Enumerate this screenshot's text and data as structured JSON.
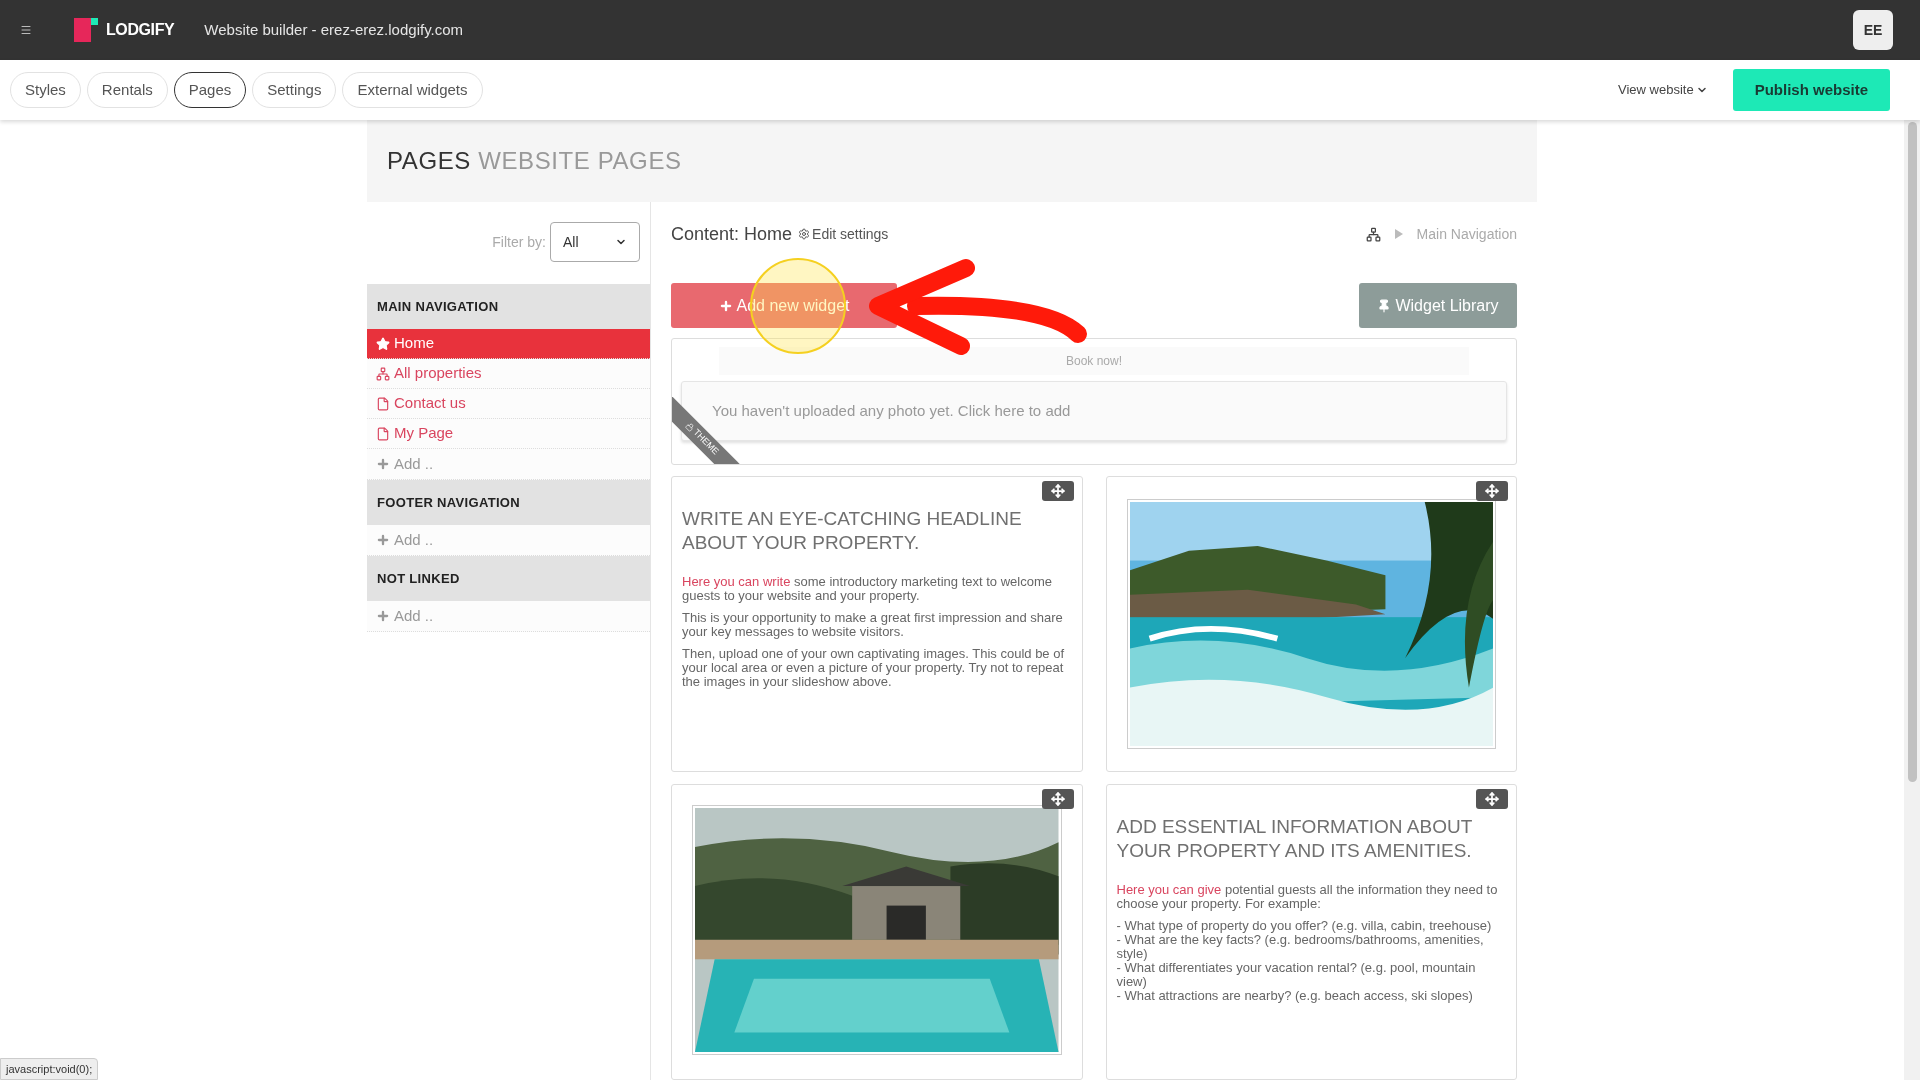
{
  "app": {
    "logo": "LODGIFY",
    "title": "Website builder - erez-erez.lodgify.com",
    "avatar": "EE"
  },
  "tabs": [
    {
      "label": "Styles",
      "selected": false
    },
    {
      "label": "Rentals",
      "selected": false
    },
    {
      "label": "Pages",
      "selected": true
    },
    {
      "label": "Settings",
      "selected": false
    },
    {
      "label": "External widgets",
      "selected": false
    }
  ],
  "view_website": "View website",
  "publish_button": "Publish website",
  "page_header": {
    "title": "PAGES",
    "subtitle": "WEBSITE PAGES"
  },
  "filter": {
    "label": "Filter by:",
    "value": "All"
  },
  "sections": [
    {
      "title": "MAIN NAVIGATION",
      "add": "Add ..",
      "items": [
        {
          "label": "Home",
          "kind": "home",
          "selected": true
        },
        {
          "label": "All properties",
          "kind": "listing",
          "selected": false
        },
        {
          "label": "Contact us",
          "kind": "page",
          "selected": false
        },
        {
          "label": "My Page",
          "kind": "page",
          "selected": false
        }
      ]
    },
    {
      "title": "FOOTER NAVIGATION",
      "add": "Add .."
    },
    {
      "title": "NOT LINKED",
      "add": "Add .."
    }
  ],
  "content": {
    "title": "Content: Home",
    "edit": "Edit settings",
    "breadcrumb": "Main Navigation",
    "add_widget": "Add new widget",
    "widget_library": "Widget Library"
  },
  "banner": {
    "button_text": "Book now!",
    "upload_prompt": "You haven't uploaded any photo yet. Click here to add",
    "ribbon": "THEME"
  },
  "widgets": [
    {
      "kind": "text",
      "headline": "WRITE AN EYE-CATCHING HEADLINE ABOUT YOUR PROPERTY.",
      "paragraphs": [
        {
          "lead": "Here you can write",
          "text": "some introductory marketing text to welcome guests to your website and your property."
        },
        {
          "text": "This is your opportunity to make a great first impression and share your key messages to website visitors."
        },
        {
          "text": "Then, upload one of your own captivating images. This could be of your local area or even a picture of your property. Try not to repeat the images in your slideshow above."
        }
      ]
    },
    {
      "kind": "picture"
    },
    {
      "kind": "picture"
    },
    {
      "kind": "text",
      "headline": "ADD ESSENTIAL INFORMATION ABOUT YOUR PROPERTY AND ITS AMENITIES.",
      "paragraphs": [
        {
          "lead": "Here you can give",
          "text": "potential guests all the information they need to choose your property. For example:"
        }
      ],
      "list": [
        "- What type of property do you offer? (e.g. villa, cabin, treehouse)",
        "- What are the key facts? (e.g. bedrooms/bathrooms, amenities, style)",
        "- What differentiates your vacation rental? (e.g. pool, mountain view)",
        "- What attractions are nearby? (e.g. beach access, ski slopes)"
      ]
    }
  ],
  "status_bar": "javascript:void(0);"
}
